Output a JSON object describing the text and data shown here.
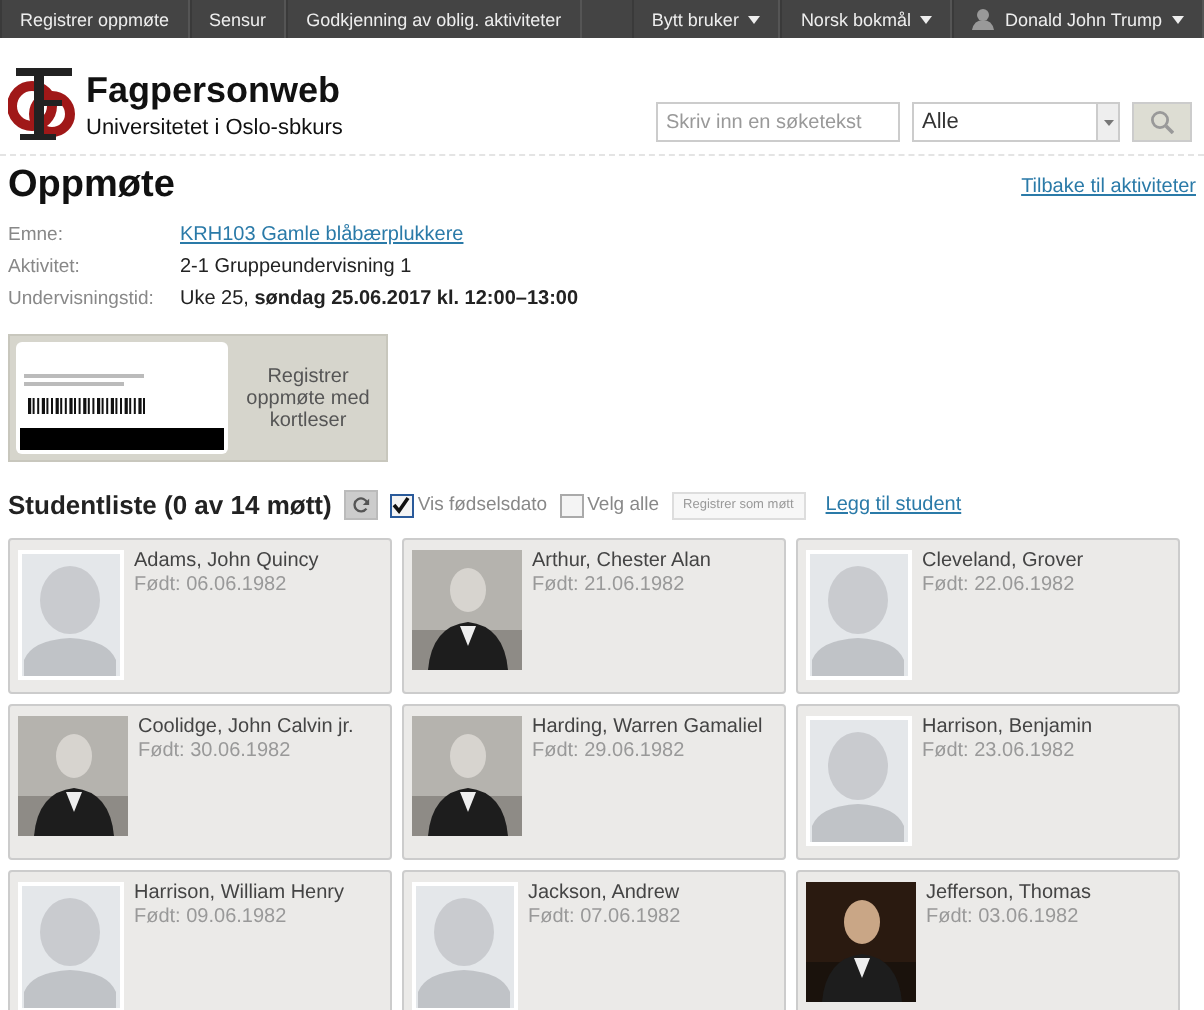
{
  "topbar": {
    "left": [
      "Registrer oppmøte",
      "Sensur",
      "Godkjenning av oblig. aktiviteter"
    ],
    "right": [
      {
        "kind": "menu",
        "label": "Bytt bruker"
      },
      {
        "kind": "menu",
        "label": "Norsk bokmål"
      },
      {
        "kind": "user",
        "label": "Donald John Trump"
      }
    ]
  },
  "header": {
    "title": "Fagpersonweb",
    "subtitle": "Universitetet i Oslo-sbkurs",
    "search": {
      "placeholder": "Skriv inn en søketekst"
    },
    "filter": "Alle"
  },
  "page": {
    "title": "Oppmøte",
    "back_link": "Tilbake til aktiviteter",
    "info": [
      {
        "label": "Emne:",
        "value": "KRH103 Gamle blåbærplukkere",
        "kind": "link"
      },
      {
        "label": "Aktivitet:",
        "value": "2-1 Gruppeundervisning 1",
        "kind": "text"
      },
      {
        "label": "Undervisningstid:",
        "value": "Uke 25, **søndag 25.06.2017 kl. 12:00–13:00**",
        "kind": "text"
      }
    ],
    "card_reader": "Registrer oppmøte med kortleser"
  },
  "student_list": {
    "title": "Studentliste (0 av 14 møtt)",
    "show_birthdate": {
      "label": "Vis fødselsdato",
      "checked": true
    },
    "select_all": {
      "label": "Velg alle",
      "checked": false
    },
    "register_button": {
      "label": "Registrer som møtt",
      "disabled": true
    },
    "add_link": "Legg til student",
    "students": [
      {
        "name": "Adams, John Quincy",
        "born": "Født: 06.06.1982",
        "kind": "avatar"
      },
      {
        "name": "Arthur, Chester Alan",
        "born": "Født: 21.06.1982"
      },
      {
        "name": "Cleveland, Grover",
        "born": "Født: 22.06.1982",
        "kind": "avatar"
      },
      {
        "name": "Coolidge, John Calvin jr.",
        "born": "Født: 30.06.1982"
      },
      {
        "name": "Harding, Warren Gamaliel",
        "born": "Født: 29.06.1982"
      },
      {
        "name": "Harrison, Benjamin",
        "born": "Født: 23.06.1982",
        "kind": "avatar"
      },
      {
        "name": "Harrison, William Henry",
        "born": "Født: 09.06.1982",
        "kind": "avatar"
      },
      {
        "name": "Jackson, Andrew",
        "born": "Født: 07.06.1982",
        "kind": "avatar"
      },
      {
        "name": "Jefferson, Thomas",
        "born": "Født: 03.06.1982"
      }
    ]
  }
}
